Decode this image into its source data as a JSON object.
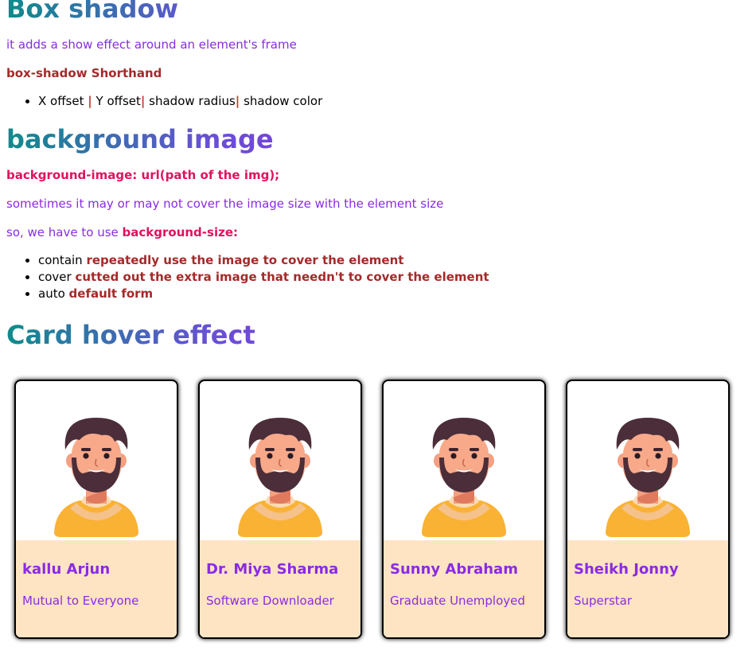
{
  "sections": {
    "box_shadow": {
      "title": "Box shadow",
      "description": "it adds a show effect around an element's frame",
      "shorthand_label": "box-shadow Shorthand",
      "syntax": [
        "X offset",
        "Y offset",
        "shadow radius",
        "shadow color"
      ]
    },
    "background_image": {
      "title": "background image",
      "code": "background-image: url(path of the img);",
      "note": "sometimes it may or may not cover the image size with the element size",
      "size_intro": "so, we have to use",
      "size_code": "background-size:",
      "options": [
        {
          "term": "contain",
          "desc": "repeatedly use the image to cover the element"
        },
        {
          "term": "cover",
          "desc": "cutted out the extra image that needn't to cover the element"
        },
        {
          "term": "auto",
          "desc": "default form"
        }
      ]
    },
    "card_hover": {
      "title": "Card hover effect"
    }
  },
  "cards": [
    {
      "name": "kallu Arjun",
      "role": "Mutual to Everyone",
      "icon": "avatar-icon"
    },
    {
      "name": "Dr. Miya Sharma",
      "role": "Software Downloader",
      "icon": "avatar-icon"
    },
    {
      "name": "Sunny Abraham",
      "role": "Graduate Unemployed",
      "icon": "avatar-icon"
    },
    {
      "name": "Sheikh Jonny",
      "role": "Superstar",
      "icon": "avatar-icon"
    }
  ],
  "colors": {
    "heading_gradient_start": "#0e8b8b",
    "heading_gradient_end": "#8a2be2",
    "text_purple": "#8a2be2",
    "text_brown": "#a52a2a",
    "code_pink": "#e0115f",
    "card_info_bg": "#ffe4c4"
  }
}
